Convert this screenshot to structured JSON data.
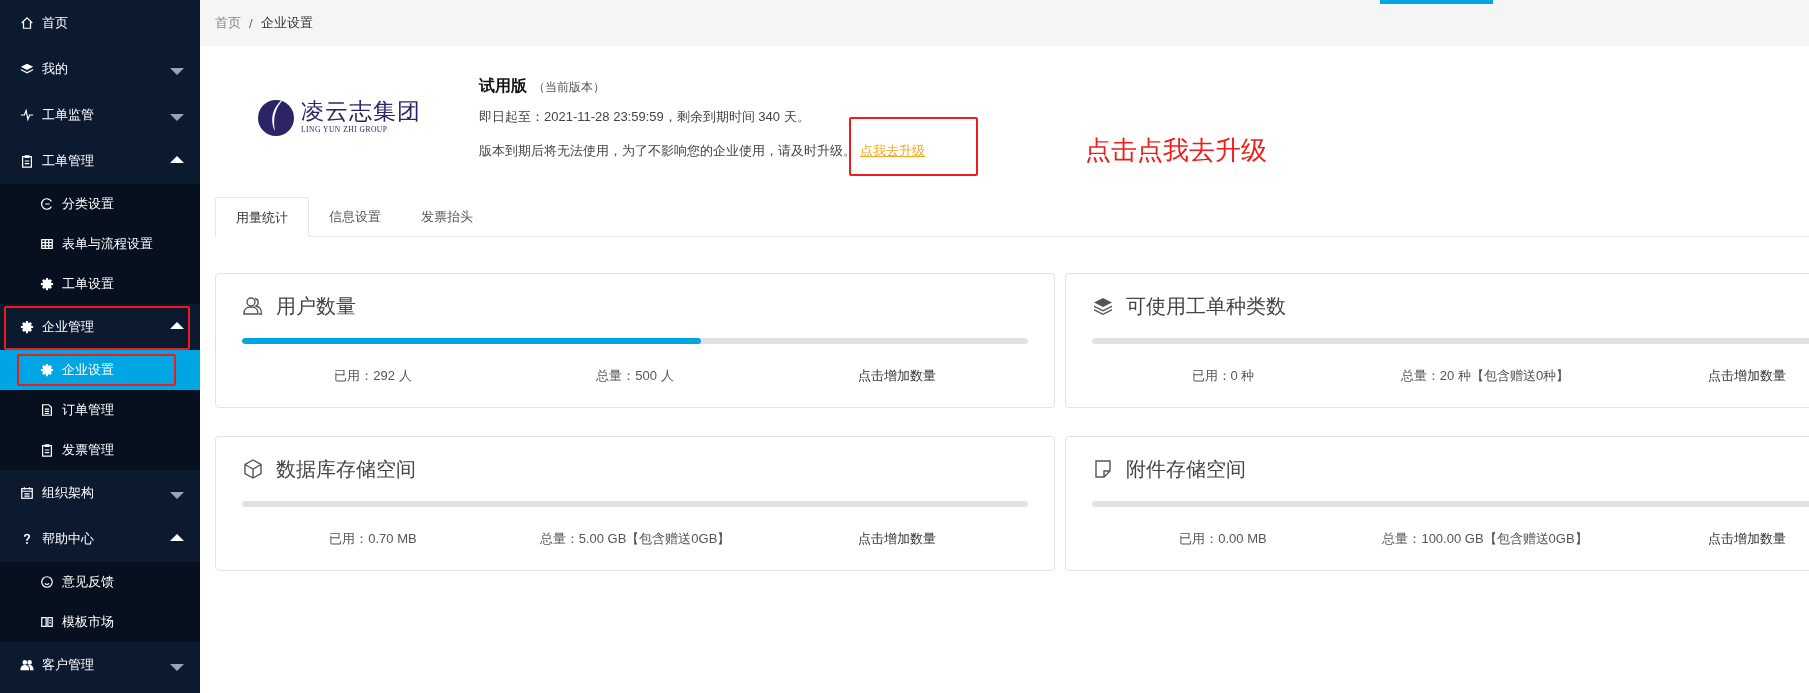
{
  "sidebar": {
    "items": [
      {
        "label": "首页",
        "kind": "link",
        "annotated": false
      },
      {
        "label": "我的",
        "kind": "group",
        "expanded": false,
        "annotated": false
      },
      {
        "label": "工单监管",
        "kind": "group",
        "expanded": false,
        "annotated": false
      },
      {
        "label": "工单管理",
        "kind": "group",
        "expanded": true,
        "annotated": false,
        "children": [
          {
            "label": "分类设置",
            "selected": false,
            "annotated": false
          },
          {
            "label": "表单与流程设置",
            "selected": false,
            "annotated": false
          },
          {
            "label": "工单设置",
            "selected": false,
            "annotated": false
          }
        ]
      },
      {
        "label": "企业管理",
        "kind": "group",
        "expanded": true,
        "annotated": true,
        "children": [
          {
            "label": "企业设置",
            "selected": true,
            "annotated": true
          },
          {
            "label": "订单管理",
            "selected": false,
            "annotated": false
          },
          {
            "label": "发票管理",
            "selected": false,
            "annotated": false
          }
        ]
      },
      {
        "label": "组织架构",
        "kind": "group",
        "expanded": false,
        "annotated": false
      },
      {
        "label": "帮助中心",
        "kind": "group",
        "expanded": true,
        "annotated": false,
        "children": [
          {
            "label": "意见反馈",
            "selected": false,
            "annotated": false
          },
          {
            "label": "模板市场",
            "selected": false,
            "annotated": false
          }
        ]
      },
      {
        "label": "客户管理",
        "kind": "group",
        "expanded": false,
        "annotated": false
      }
    ]
  },
  "breadcrumb": {
    "separator": "/",
    "items": [
      {
        "label": "首页",
        "current": false
      },
      {
        "label": "企业设置",
        "current": true
      }
    ]
  },
  "header": {
    "logo": {
      "name": "凌云志集团",
      "subtitle": "LING YUN ZHI GROUP"
    },
    "plan": {
      "name": "试用版",
      "note": "（当前版本）"
    },
    "expiry_text": "即日起至：2021-11-28 23:59:59，剩余到期时间 340 天。",
    "warning_text": "版本到期后将无法使用，为了不影响您的企业使用，请及时升级。",
    "upgrade_link": {
      "label": "点我去升级",
      "annotated": true
    },
    "annotation_text": "点击点我去升级"
  },
  "tabs": [
    {
      "label": "用量统计",
      "selected": true
    },
    {
      "label": "信息设置",
      "selected": false
    },
    {
      "label": "发票抬头",
      "selected": false
    }
  ],
  "cards": [
    {
      "title": "用户数量",
      "level": 0.584,
      "used": "已用：292 人",
      "total": "总量：500 人",
      "action": "点击增加数量"
    },
    {
      "title": "可使用工单种类数",
      "level": 0,
      "used": "已用：0 种",
      "total": "总量：20 种【包含赠送0种】",
      "action": "点击增加数量"
    },
    {
      "title": "数据库存储空间",
      "level": 0,
      "used": "已用：0.70 MB",
      "total": "总量：5.00 GB【包含赠送0GB】",
      "action": "点击增加数量"
    },
    {
      "title": "附件存储空间",
      "level": 0,
      "used": "已用：0.00 MB",
      "total": "总量：100.00 GB【包含赠送0GB】",
      "action": "点击增加数量"
    }
  ]
}
